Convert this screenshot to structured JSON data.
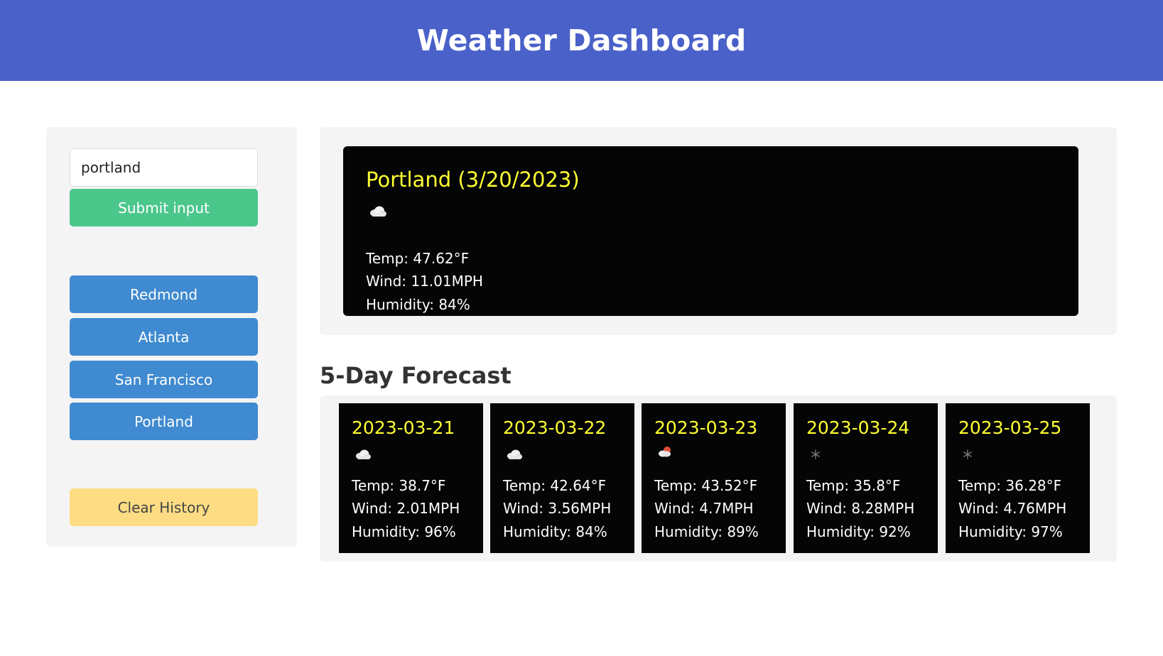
{
  "colors": {
    "header_bg": "#4a61c9",
    "submit_bg": "#4cc78c",
    "city_bg": "#3f8ad0",
    "clear_bg": "#fddc84",
    "accent_yellow": "#ffff33"
  },
  "header": {
    "title": "Weather Dashboard"
  },
  "search": {
    "value": "portland",
    "submit_label": "Submit input"
  },
  "history": [
    "Redmond",
    "Atlanta",
    "San Francisco",
    "Portland"
  ],
  "clear_label": "Clear History",
  "current": {
    "title": "Portland (3/20/2023)",
    "icon": "cloud-icon",
    "temp": "Temp: 47.62°F",
    "wind": "Wind: 11.01MPH",
    "humidity": "Humidity: 84%"
  },
  "forecast_title": "5-Day Forecast",
  "forecast": [
    {
      "date": "2023-03-21",
      "icon": "cloud-icon",
      "temp": "Temp: 38.7°F",
      "wind": "Wind: 2.01MPH",
      "humidity": "Humidity: 96%"
    },
    {
      "date": "2023-03-22",
      "icon": "cloud-icon",
      "temp": "Temp: 42.64°F",
      "wind": "Wind: 3.56MPH",
      "humidity": "Humidity: 84%"
    },
    {
      "date": "2023-03-23",
      "icon": "rain-cloud-icon",
      "temp": "Temp: 43.52°F",
      "wind": "Wind: 4.7MPH",
      "humidity": "Humidity: 89%"
    },
    {
      "date": "2023-03-24",
      "icon": "snowflake-icon",
      "temp": "Temp: 35.8°F",
      "wind": "Wind: 8.28MPH",
      "humidity": "Humidity: 92%"
    },
    {
      "date": "2023-03-25",
      "icon": "snowflake-icon",
      "temp": "Temp: 36.28°F",
      "wind": "Wind: 4.76MPH",
      "humidity": "Humidity: 97%"
    }
  ]
}
